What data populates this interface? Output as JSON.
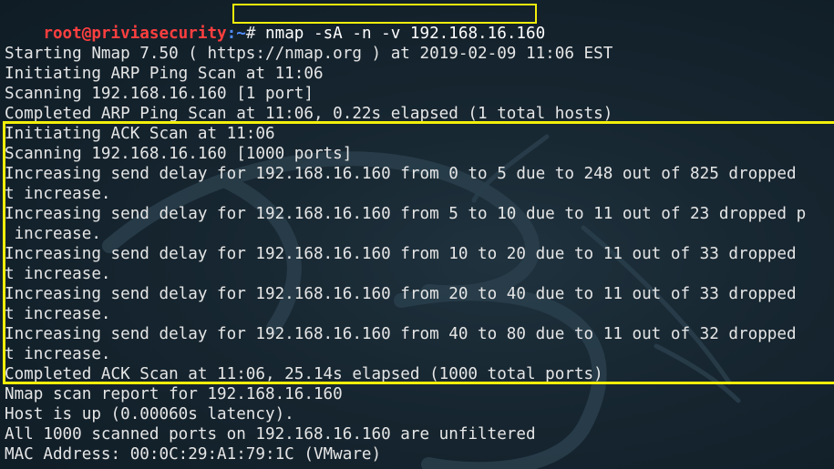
{
  "terminal": {
    "prompt": {
      "user_host": "root@priviasecurity",
      "path": ":~",
      "symbol": "# ",
      "command": "nmap -sA -n -v 192.168.16.160"
    },
    "lines": [
      "",
      "Starting Nmap 7.50 ( https://nmap.org ) at 2019-02-09 11:06 EST",
      "Initiating ARP Ping Scan at 11:06",
      "Scanning 192.168.16.160 [1 port]",
      "Completed ARP Ping Scan at 11:06, 0.22s elapsed (1 total hosts)",
      "Initiating ACK Scan at 11:06",
      "Scanning 192.168.16.160 [1000 ports]",
      "Increasing send delay for 192.168.16.160 from 0 to 5 due to 248 out of 825 dropped",
      "t increase.",
      "Increasing send delay for 192.168.16.160 from 5 to 10 due to 11 out of 23 dropped p",
      " increase.",
      "Increasing send delay for 192.168.16.160 from 10 to 20 due to 11 out of 33 dropped",
      "t increase.",
      "Increasing send delay for 192.168.16.160 from 20 to 40 due to 11 out of 33 dropped",
      "t increase.",
      "Increasing send delay for 192.168.16.160 from 40 to 80 due to 11 out of 32 dropped",
      "t increase.",
      "Completed ACK Scan at 11:06, 25.14s elapsed (1000 total ports)",
      "Nmap scan report for 192.168.16.160",
      "Host is up (0.00060s latency).",
      "All 1000 scanned ports on 192.168.16.160 are unfiltered",
      "MAC Address: 00:0C:29:A1:79:1C (VMware)"
    ]
  },
  "colors": {
    "background": "#0f1c26",
    "text": "#e6e6e6",
    "prompt_user": "#ff3f3f",
    "prompt_path": "#4f8cff",
    "highlight": "#f2ee0a"
  },
  "icons": {
    "background_logo": "kali-dragon-icon"
  }
}
